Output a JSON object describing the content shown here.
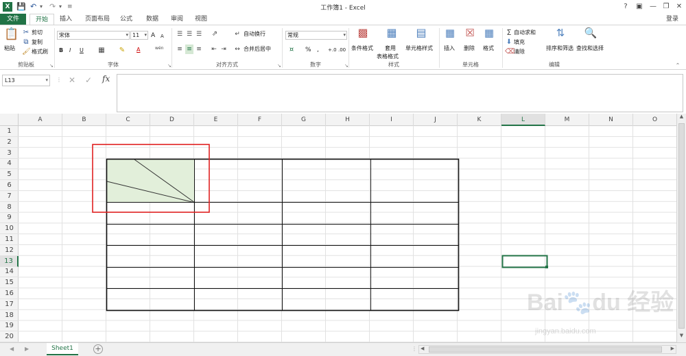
{
  "window": {
    "title": "工作簿1 - Excel",
    "app_icon": "X",
    "help": "?",
    "login": "登录"
  },
  "tabs": [
    "文件",
    "开始",
    "插入",
    "页面布局",
    "公式",
    "数据",
    "审阅",
    "视图"
  ],
  "ribbon": {
    "clipboard": {
      "label": "剪贴板",
      "paste": "粘贴",
      "cut": "剪切",
      "copy": "复制",
      "format_painter": "格式刷"
    },
    "font": {
      "label": "字体",
      "name": "宋体",
      "size": "11",
      "bold": "B",
      "italic": "I",
      "underline": "U",
      "grow": "A",
      "shrink": "A",
      "font_color": "A",
      "wen": "wén"
    },
    "alignment": {
      "label": "对齐方式",
      "wrap": "自动换行",
      "merge": "合并后居中"
    },
    "number": {
      "label": "数字",
      "format": "常规",
      "percent": "%",
      "comma": ",",
      "inc": "+.0",
      "dec": ".00"
    },
    "styles": {
      "label": "样式",
      "cond": "条件格式",
      "table1": "套用",
      "table2": "表格格式",
      "cell": "单元格样式"
    },
    "cells": {
      "label": "单元格",
      "insert": "插入",
      "delete": "删除",
      "format": "格式"
    },
    "editing": {
      "label": "编辑",
      "autosum": "自动求和",
      "fill": "填充",
      "clear": "清除",
      "sort": "排序和筛选",
      "find": "查找和选择"
    }
  },
  "formula": {
    "namebox": "L13",
    "fx": "fx",
    "value": ""
  },
  "columns": [
    "A",
    "B",
    "C",
    "D",
    "E",
    "F",
    "G",
    "H",
    "I",
    "J",
    "K",
    "L",
    "M",
    "N",
    "O"
  ],
  "rows": [
    "1",
    "2",
    "3",
    "4",
    "5",
    "6",
    "7",
    "8",
    "9",
    "10",
    "11",
    "12",
    "13",
    "14",
    "15",
    "16",
    "17",
    "18",
    "19",
    "20"
  ],
  "selected": {
    "column": "L",
    "row": "13"
  },
  "sheet": {
    "name": "Sheet1"
  },
  "colors": {
    "accent": "#217346",
    "highlight": "#e2efda",
    "annotation": "#e02020"
  }
}
